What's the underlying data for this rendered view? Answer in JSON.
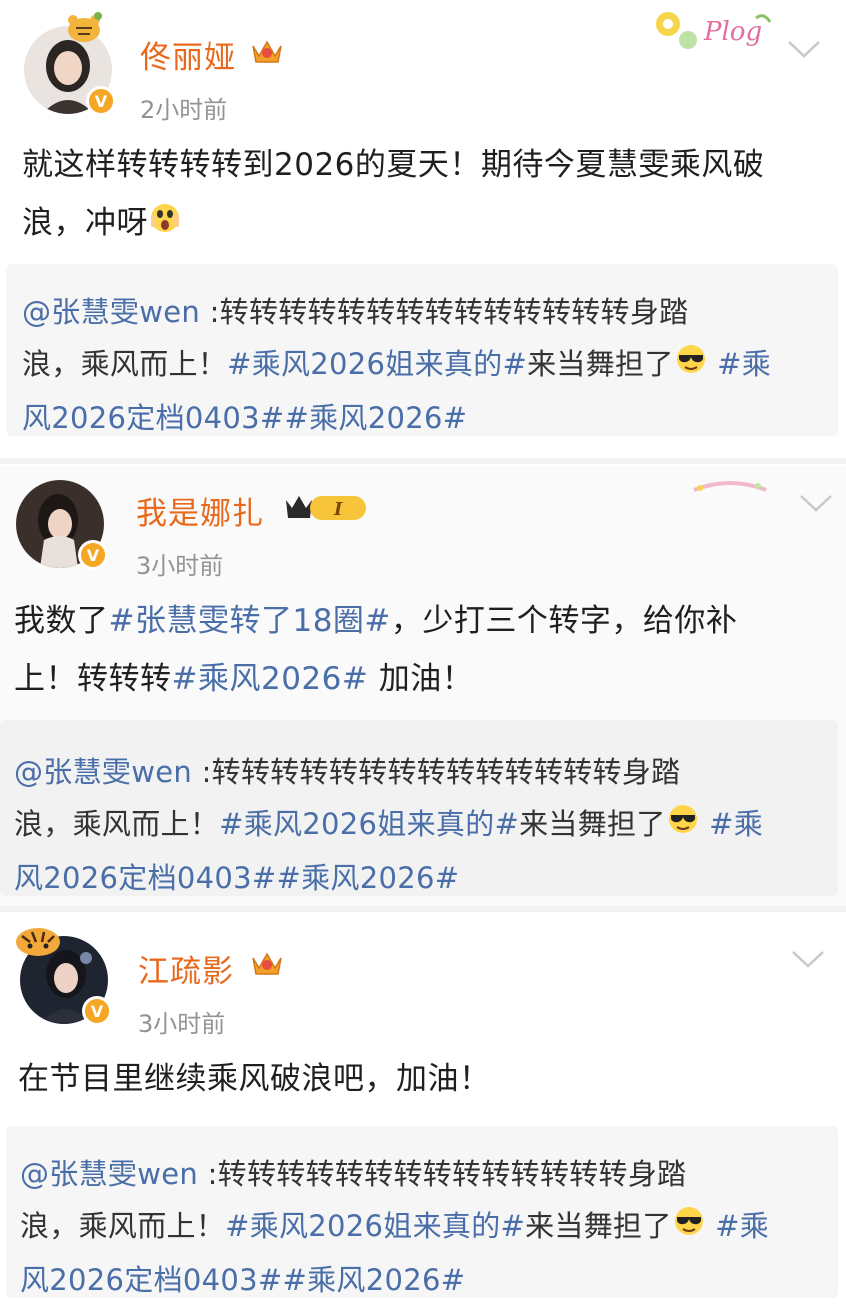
{
  "posts": [
    {
      "author": "佟丽娅",
      "time": "2小时前",
      "text_before": "就这样转转转转到2026的夏天！期待今夏慧雯乘风破",
      "text_line2": "浪，冲呀",
      "sticker": "Plog",
      "quote": {
        "at": "@张慧雯wen",
        "sep": " :",
        "body1": "转转转转转转转转转转转转转转身踏",
        "body2a": "浪，乘风而上！",
        "tag1": "#乘风2026姐来真的#",
        "body2b": "来当舞担了",
        "tag2a": "#乘",
        "tag2b": "风2026定档0403#",
        "tag3": "#乘风2026#"
      }
    },
    {
      "author": "我是娜扎",
      "time": "3小时前",
      "level": "I",
      "text_a": "我数了",
      "tag_a": "#张慧雯转了18圈#",
      "text_b": "，少打三个转字，给你补",
      "text_c": "上！转转转",
      "tag_b": "#乘风2026#",
      "text_d": " 加油！",
      "quote": {
        "at": "@张慧雯wen",
        "sep": " :",
        "body1": "转转转转转转转转转转转转转转身踏",
        "body2a": "浪，乘风而上！",
        "tag1": "#乘风2026姐来真的#",
        "body2b": "来当舞担了",
        "tag2a": "#乘",
        "tag2b": "风2026定档0403#",
        "tag3": "#乘风2026#"
      }
    },
    {
      "author": "江疏影",
      "time": "3小时前",
      "text": "在节目里继续乘风破浪吧，加油！",
      "quote": {
        "at": "@张慧雯wen",
        "sep": " :",
        "body1": "转转转转转转转转转转转转转转身踏",
        "body2a": "浪，乘风而上！",
        "tag1": "#乘风2026姐来真的#",
        "body2b": "来当舞担了",
        "tag2a": "#乘",
        "tag2b": "风2026定档0403#",
        "tag3": "#乘风2026#"
      }
    }
  ],
  "icons": {
    "verified": "verified-badge-icon",
    "crown": "crown-icon",
    "chevron": "chevron-down-icon",
    "emoji_cool": "sunglasses-emoji-icon",
    "emoji_scream": "screaming-emoji-icon"
  },
  "colors": {
    "name": "#e8691c",
    "hashtag": "#4a6ea8",
    "quote_bg": "#f6f6f6",
    "time": "#939393"
  }
}
